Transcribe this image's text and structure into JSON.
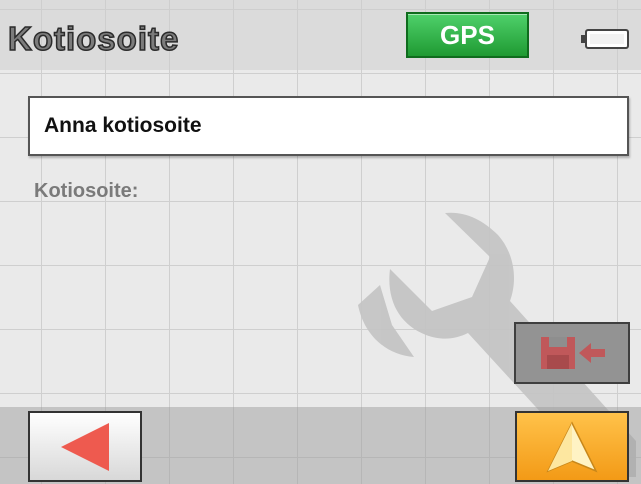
{
  "header": {
    "title": "Kotiosoite",
    "gps_label": "GPS",
    "gps_color": "#22a33a"
  },
  "input": {
    "value": "Anna kotiosoite"
  },
  "field": {
    "label": "Kotiosoite:"
  },
  "icons": {
    "battery": "battery-icon",
    "background": "wrench-icon",
    "save": "save-to-memory-icon",
    "back": "back-arrow-icon",
    "navigate": "navigate-arrow-icon"
  },
  "colors": {
    "accent": "#f5a623",
    "back_arrow": "#ee5a4f",
    "save_icon": "#c0585a"
  }
}
